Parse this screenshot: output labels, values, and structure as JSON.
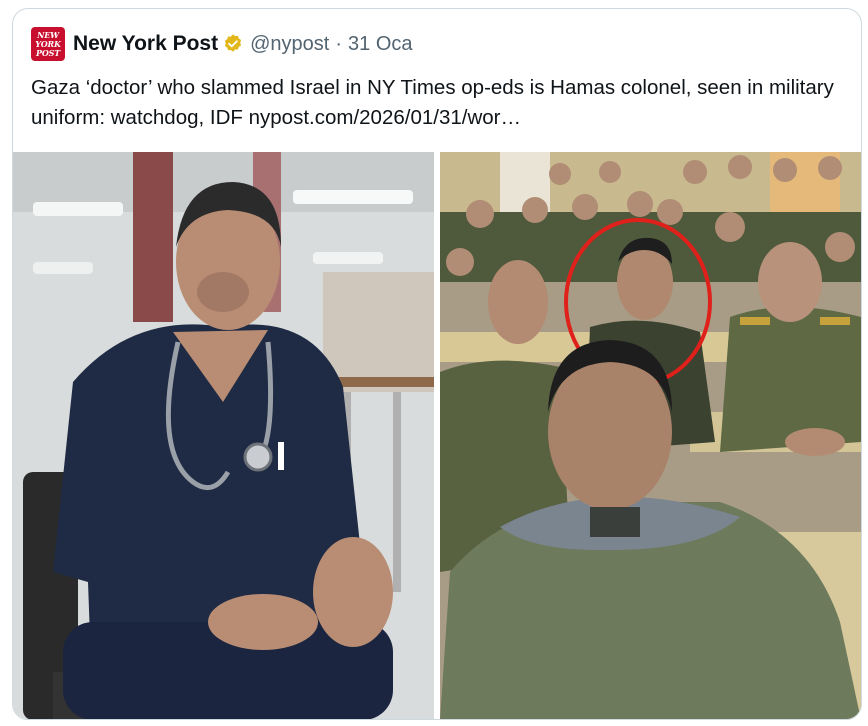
{
  "tweet": {
    "author_name": "New York Post",
    "handle": "@nypost",
    "separator": "·",
    "date": "31 Oca",
    "avatar_text": [
      "NEW",
      "YORK",
      "POST"
    ],
    "text": "Gaza ‘doctor’ who slammed Israel in NY Times op-eds is Hamas colonel, seen in military uniform: watchdog, IDF ",
    "link": "nypost.com/2026/01/31/wor…"
  },
  "media": {
    "left_photo": "doctor-in-scrubs-photo",
    "right_photo": "military-uniform-group-photo"
  },
  "colors": {
    "brand_red": "#c8102e",
    "verified_gold": "#e2b719",
    "secondary_text": "#536471",
    "highlight_circle": "#e0201b",
    "scrubs_navy": "#1f2a44",
    "uniform_olive": "#6f7a4f"
  },
  "icons": {
    "verified": "verified-badge-icon"
  }
}
